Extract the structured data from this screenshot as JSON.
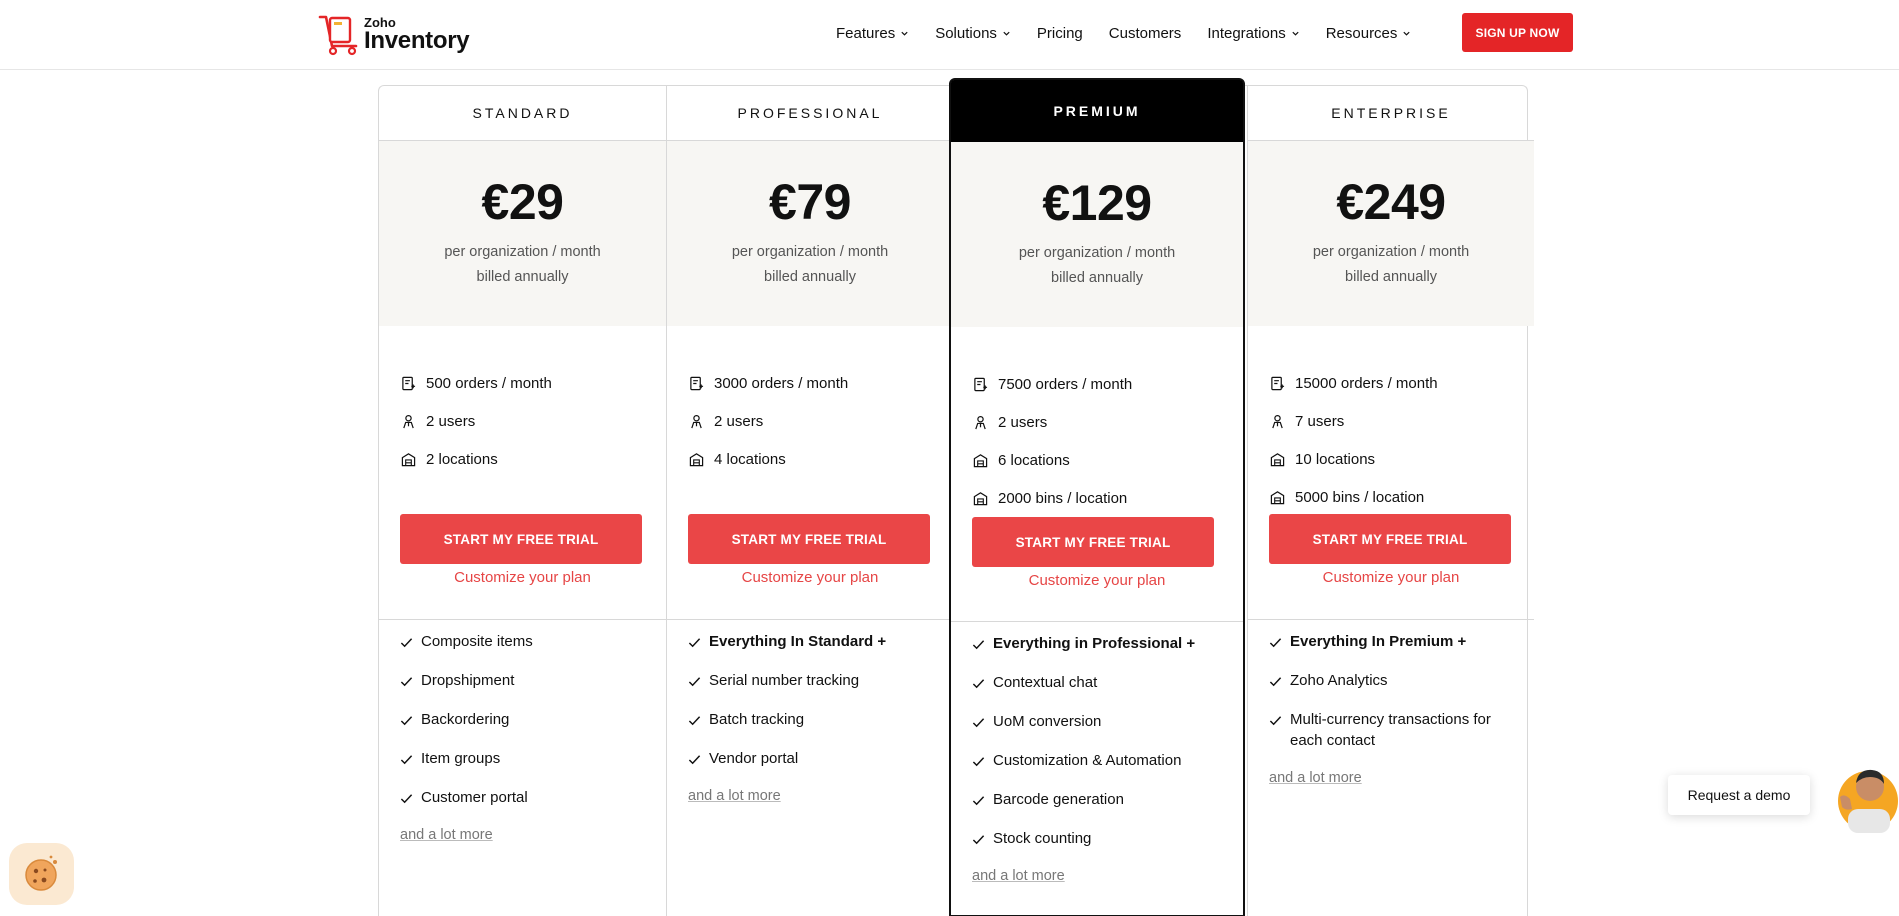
{
  "header": {
    "logo_brand": "Zoho",
    "logo_product": "Inventory",
    "nav": [
      {
        "label": "Features",
        "dropdown": true
      },
      {
        "label": "Solutions",
        "dropdown": true
      },
      {
        "label": "Pricing",
        "dropdown": false
      },
      {
        "label": "Customers",
        "dropdown": false
      },
      {
        "label": "Integrations",
        "dropdown": true
      },
      {
        "label": "Resources",
        "dropdown": true
      }
    ],
    "signup_label": "SIGN UP NOW"
  },
  "plans": [
    {
      "name": "STANDARD",
      "price": "€29",
      "price_line1": "per organization / month",
      "price_line2": "billed annually",
      "limits": [
        {
          "icon": "orders-icon",
          "text": "500 orders / month"
        },
        {
          "icon": "user-icon",
          "text": "2 users"
        },
        {
          "icon": "warehouse-icon",
          "text": "2 locations"
        }
      ],
      "cta": "START MY FREE TRIAL",
      "customize": "Customize your plan",
      "features": [
        {
          "text": "Composite items",
          "bold": false
        },
        {
          "text": "Dropshipment",
          "bold": false
        },
        {
          "text": "Backordering",
          "bold": false
        },
        {
          "text": "Item groups",
          "bold": false
        },
        {
          "text": "Customer portal",
          "bold": false
        }
      ],
      "more": "and a lot more"
    },
    {
      "name": "PROFESSIONAL",
      "price": "€79",
      "price_line1": "per organization / month",
      "price_line2": "billed annually",
      "limits": [
        {
          "icon": "orders-icon",
          "text": "3000 orders / month"
        },
        {
          "icon": "user-icon",
          "text": "2 users"
        },
        {
          "icon": "warehouse-icon",
          "text": "4 locations"
        }
      ],
      "cta": "START MY FREE TRIAL",
      "customize": "Customize your plan",
      "features": [
        {
          "text": "Everything In Standard +",
          "bold": true
        },
        {
          "text": "Serial number tracking",
          "bold": false
        },
        {
          "text": "Batch tracking",
          "bold": false
        },
        {
          "text": "Vendor portal",
          "bold": false
        }
      ],
      "more": "and a lot more"
    },
    {
      "name": "PREMIUM",
      "price": "€129",
      "price_line1": "per organization / month",
      "price_line2": "billed annually",
      "limits": [
        {
          "icon": "orders-icon",
          "text": "7500 orders / month"
        },
        {
          "icon": "user-icon",
          "text": "2 users"
        },
        {
          "icon": "warehouse-icon",
          "text": "6 locations"
        },
        {
          "icon": "warehouse-icon",
          "text": "2000 bins / location"
        }
      ],
      "cta": "START MY FREE TRIAL",
      "customize": "Customize your plan",
      "features": [
        {
          "text": "Everything in Professional +",
          "bold": true
        },
        {
          "text": "Contextual chat",
          "bold": false
        },
        {
          "text": "UoM conversion",
          "bold": false
        },
        {
          "text": "Customization & Automation",
          "bold": false
        },
        {
          "text": "Barcode generation",
          "bold": false
        },
        {
          "text": "Stock counting",
          "bold": false
        }
      ],
      "more": "and a lot more"
    },
    {
      "name": "ENTERPRISE",
      "price": "€249",
      "price_line1": "per organization / month",
      "price_line2": "billed annually",
      "limits": [
        {
          "icon": "orders-icon",
          "text": "15000 orders / month"
        },
        {
          "icon": "user-icon",
          "text": "7 users"
        },
        {
          "icon": "warehouse-icon",
          "text": "10 locations"
        },
        {
          "icon": "warehouse-icon",
          "text": "5000 bins / location"
        }
      ],
      "cta": "START MY FREE TRIAL",
      "customize": "Customize your plan",
      "features": [
        {
          "text": "Everything In Premium +",
          "bold": true
        },
        {
          "text": "Zoho Analytics",
          "bold": false
        },
        {
          "text": "Multi-currency transactions for each contact",
          "bold": false
        }
      ],
      "more": "and a lot more"
    }
  ],
  "demo_label": "Request a demo",
  "colors": {
    "brand_red": "#e42527",
    "cta_red": "#ea4647",
    "link_red": "#e64545",
    "price_bg": "#f7f6f3",
    "premium_head": "#000000"
  }
}
